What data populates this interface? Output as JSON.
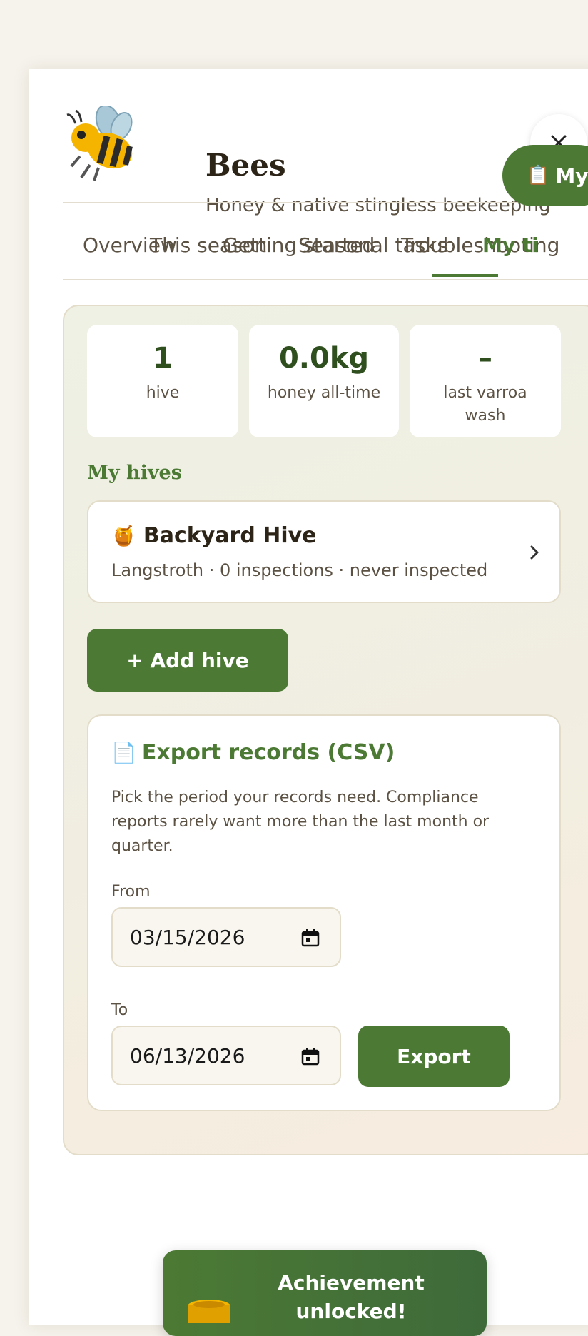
{
  "header": {
    "title": "Bees",
    "subtitle": "Honey & native stingless beekeeping",
    "close_icon": "close-icon"
  },
  "tabs": [
    {
      "label": "Overview"
    },
    {
      "label": "This season"
    },
    {
      "label": "Getting started"
    },
    {
      "label": "Seasonal tasks"
    },
    {
      "label": "Troubleshooting"
    },
    {
      "label": "My tips",
      "visible_text": "My ti",
      "active": true
    }
  ],
  "pill_button": {
    "icon": "clipboard-icon",
    "label": "My"
  },
  "stats": [
    {
      "value": "1",
      "label": "hive"
    },
    {
      "value": "0.0kg",
      "label": "honey all-time"
    },
    {
      "value": "–",
      "label": "last varroa wash"
    }
  ],
  "hives_section": {
    "title": "My hives",
    "hives": [
      {
        "icon": "honey-pot-icon",
        "name": "Backyard Hive",
        "meta": "Langstroth · 0 inspections · never inspected"
      }
    ],
    "add_label": "+ Add hive"
  },
  "export": {
    "icon": "document-icon",
    "title": "Export records (CSV)",
    "description": "Pick the period your records need. Compliance reports rarely want more than the last month or quarter.",
    "from_label": "From",
    "from_value": "03/15/2026",
    "to_label": "To",
    "to_value": "06/13/2026",
    "button_label": "Export"
  },
  "toast": {
    "title": "Achievement unlocked!",
    "icon": "honey-pot-icon"
  },
  "colors": {
    "accent": "#4c7a34",
    "stat_value": "#2f4f1f",
    "text": "#2d2418",
    "muted": "#5c5244"
  }
}
